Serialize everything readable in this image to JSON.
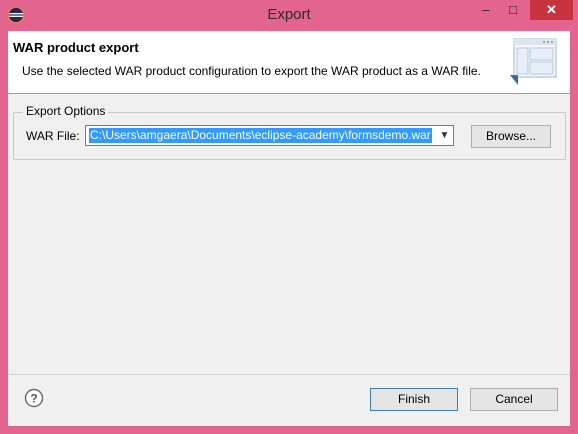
{
  "window": {
    "title": "Export",
    "controls": {
      "minimize": "–",
      "maximize": "□",
      "close": "✕"
    },
    "colors": {
      "frame": "#e3658f",
      "close": "#c7333f",
      "selection": "#3399ff"
    }
  },
  "banner": {
    "title": "WAR product export",
    "description": "Use the selected WAR product configuration to export the WAR product as a WAR file.",
    "graphic_icon": "wizard-banner-icon"
  },
  "export_options": {
    "legend": "Export Options",
    "war_file_label": "WAR File:",
    "war_file_value": "C:\\Users\\amgaera\\Documents\\eclipse-academy\\formsdemo.war",
    "browse_label": "Browse..."
  },
  "footer": {
    "help_icon": "help-icon",
    "finish_label": "Finish",
    "cancel_label": "Cancel"
  }
}
